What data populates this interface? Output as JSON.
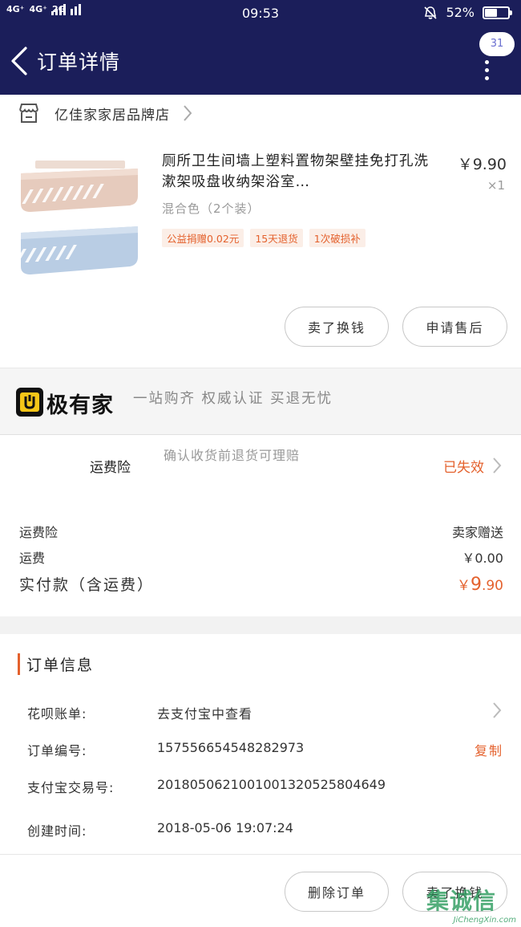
{
  "status_bar": {
    "network": [
      "4G⁺",
      "4G⁺",
      "2G"
    ],
    "network_sub": [
      "↑↓",
      "2G",
      ""
    ],
    "time": "09:53",
    "battery_percent": "52%",
    "battery_level": 0.52
  },
  "nav": {
    "title": "订单详情",
    "message_count": "31"
  },
  "shop": {
    "name": "亿佳家家居品牌店"
  },
  "product": {
    "title": "厕所卫生间墙上塑料置物架壁挂免打孔洗漱架吸盘收纳架浴室…",
    "price": "￥9.90",
    "quantity": "×1",
    "sku": "混合色（2个装）",
    "tags": [
      "公益捐赠0.02元",
      "15天退货",
      "1次破损补"
    ]
  },
  "buttons": {
    "sell_exchange": "卖了换钱",
    "after_sale": "申请售后",
    "delete_order": "删除订单"
  },
  "brand": {
    "name": "极有家",
    "slogan": "一站购齐 权威认证 买退无忧"
  },
  "insurance": {
    "label": "运费险",
    "desc": "确认收货前退货可理赔",
    "status": "已失效"
  },
  "summary": {
    "rows": [
      {
        "label": "运费险",
        "value": "卖家赠送"
      },
      {
        "label": "运费",
        "value": "￥0.00"
      }
    ],
    "paid_label": "实付款（含运费）",
    "paid_currency": "￥",
    "paid_int": "9",
    "paid_dec": ".90"
  },
  "order_info": {
    "title": "订单信息",
    "huabei_label": "花呗账单:",
    "huabei_value": "去支付宝中查看",
    "order_no_label": "订单编号:",
    "order_no": "157556654548282973",
    "copy_label": "复制",
    "alipay_label": "支付宝交易号:",
    "alipay_no": "2018050621001001320525804649",
    "created_label": "创建时间:",
    "created_time": "2018-05-06 19:07:24"
  },
  "watermark": {
    "cn": "集诚信",
    "en": "JiChengXin.com"
  },
  "colors": {
    "nav_bg": "#1b1e5a",
    "accent": "#e4612d"
  }
}
